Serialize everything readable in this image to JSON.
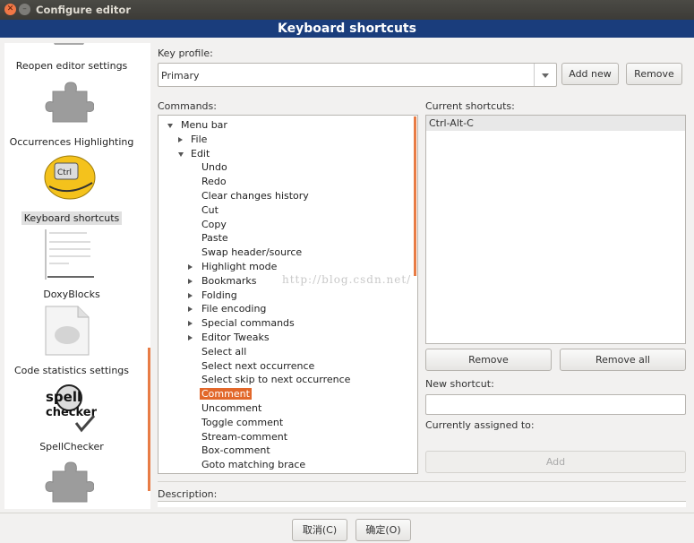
{
  "window": {
    "title": "Configure editor"
  },
  "banner": {
    "title": "Keyboard shortcuts"
  },
  "sidebar": {
    "items": [
      {
        "label": "Reopen editor settings",
        "icon": "puzzle-icon"
      },
      {
        "label": "Occurrences Highlighting",
        "icon": "puzzle-icon"
      },
      {
        "label": "Keyboard shortcuts",
        "icon": "keyboard-ctrl-icon",
        "selected": true
      },
      {
        "label": "DoxyBlocks",
        "icon": "doxyblocks-icon"
      },
      {
        "label": "Code statistics settings",
        "icon": "document-icon"
      },
      {
        "label": "SpellChecker",
        "icon": "spellchecker-icon"
      },
      {
        "label": "",
        "icon": "puzzle-icon"
      }
    ]
  },
  "profile": {
    "label": "Key profile:",
    "value": "Primary",
    "add_new": "Add new",
    "remove": "Remove"
  },
  "commands": {
    "label": "Commands:",
    "rows": [
      {
        "text": "Menu bar",
        "depth": 0,
        "expander": "down"
      },
      {
        "text": "File",
        "depth": 1,
        "expander": "right"
      },
      {
        "text": "Edit",
        "depth": 1,
        "expander": "down"
      },
      {
        "text": "Undo",
        "depth": 2,
        "expander": ""
      },
      {
        "text": "Redo",
        "depth": 2,
        "expander": ""
      },
      {
        "text": "Clear changes history",
        "depth": 2,
        "expander": ""
      },
      {
        "text": "Cut",
        "depth": 2,
        "expander": ""
      },
      {
        "text": "Copy",
        "depth": 2,
        "expander": ""
      },
      {
        "text": "Paste",
        "depth": 2,
        "expander": ""
      },
      {
        "text": "Swap header/source",
        "depth": 2,
        "expander": ""
      },
      {
        "text": "Highlight mode",
        "depth": 2,
        "expander": "right"
      },
      {
        "text": "Bookmarks",
        "depth": 2,
        "expander": "right"
      },
      {
        "text": "Folding",
        "depth": 2,
        "expander": "right"
      },
      {
        "text": "File encoding",
        "depth": 2,
        "expander": "right"
      },
      {
        "text": "Special commands",
        "depth": 2,
        "expander": "right"
      },
      {
        "text": "Editor Tweaks",
        "depth": 2,
        "expander": "right"
      },
      {
        "text": "Select all",
        "depth": 2,
        "expander": ""
      },
      {
        "text": "Select next occurrence",
        "depth": 2,
        "expander": ""
      },
      {
        "text": "Select skip to next occurrence",
        "depth": 2,
        "expander": ""
      },
      {
        "text": "Comment",
        "depth": 2,
        "expander": "",
        "selected": true
      },
      {
        "text": "Uncomment",
        "depth": 2,
        "expander": ""
      },
      {
        "text": "Toggle comment",
        "depth": 2,
        "expander": ""
      },
      {
        "text": "Stream-comment",
        "depth": 2,
        "expander": ""
      },
      {
        "text": "Box-comment",
        "depth": 2,
        "expander": ""
      },
      {
        "text": "Goto matching brace",
        "depth": 2,
        "expander": ""
      }
    ]
  },
  "shortcuts": {
    "label": "Current shortcuts:",
    "items": [
      "Ctrl-Alt-C"
    ],
    "remove": "Remove",
    "remove_all": "Remove all",
    "new_label": "New shortcut:",
    "new_value": "",
    "assigned_label": "Currently assigned to:",
    "add": "Add"
  },
  "description": {
    "label": "Description:"
  },
  "watermark": "http://blog.csdn.net/",
  "footer": {
    "cancel": "取消(C)",
    "ok": "确定(O)"
  },
  "colors": {
    "accent": "#e2682b",
    "banner": "#1a3d7c",
    "titlebar": "#3c3b37"
  }
}
